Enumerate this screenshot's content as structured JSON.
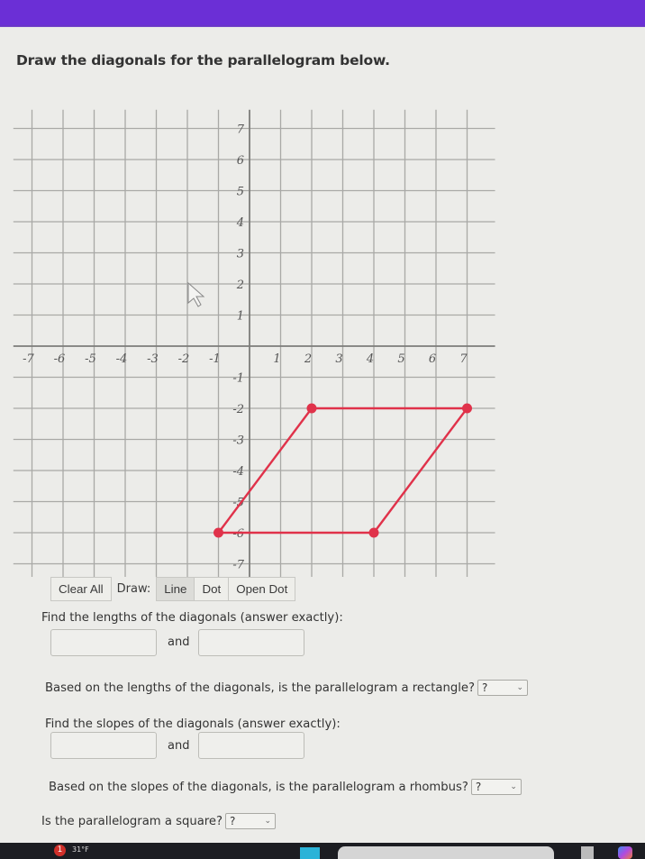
{
  "header": {
    "accent_color": "#6b2fd6"
  },
  "prompt": "Draw the diagonals for the parallelogram below.",
  "chart_data": {
    "type": "scatter",
    "title": "",
    "xlabel": "",
    "ylabel": "",
    "xlim": [
      -7,
      7
    ],
    "ylim": [
      -7,
      7
    ],
    "grid": true,
    "x_ticks": [
      -7,
      -6,
      -5,
      -4,
      -3,
      -2,
      -1,
      1,
      2,
      3,
      4,
      5,
      6,
      7
    ],
    "y_ticks": [
      7,
      6,
      5,
      4,
      3,
      2,
      1,
      -1,
      -2,
      -3,
      -4,
      -5,
      -6,
      -7
    ],
    "series": [
      {
        "name": "parallelogram",
        "closed": true,
        "color": "#e0324a",
        "points": [
          [
            2,
            -2
          ],
          [
            7,
            -2
          ],
          [
            4,
            -6
          ],
          [
            -1,
            -6
          ]
        ]
      }
    ]
  },
  "toolbar": {
    "clear_label": "Clear All",
    "draw_label": "Draw:",
    "tools": [
      {
        "label": "Line",
        "active": true
      },
      {
        "label": "Dot",
        "active": false
      },
      {
        "label": "Open Dot",
        "active": false
      }
    ]
  },
  "questions": {
    "lengths_prompt": "Find the lengths of the diagonals (answer exactly):",
    "lengths_input1": "",
    "lengths_input2": "",
    "and_label": "and",
    "rectangle_prompt": "Based on the lengths of the diagonals, is the parallelogram a rectangle?",
    "rectangle_select": "?",
    "slopes_prompt": "Find the slopes of the diagonals (answer exactly):",
    "slopes_input1": "",
    "slopes_input2": "",
    "rhombus_prompt": "Based on the slopes of the diagonals, is the parallelogram a rhombus?",
    "rhombus_select": "?",
    "square_prompt": "Is the parallelogram a square?",
    "square_select": "?"
  },
  "taskbar": {
    "notification_count": "1",
    "temperature": "31°F"
  }
}
